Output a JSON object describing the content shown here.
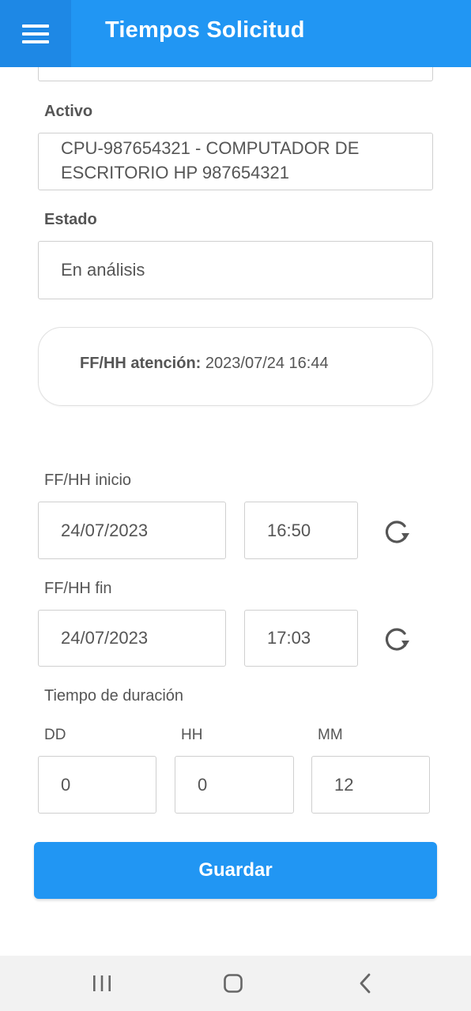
{
  "header": {
    "title": "Tiempos Solicitud",
    "menu_icon": "hamburger-menu-icon",
    "color": "#2196f3"
  },
  "form": {
    "activo": {
      "label": "Activo",
      "value": "CPU-987654321 - COMPUTADOR DE ESCRITORIO HP 987654321"
    },
    "estado": {
      "label": "Estado",
      "value": "En análisis"
    },
    "atencion": {
      "label": "FF/HH atención:",
      "value": "2023/07/24 16:44"
    },
    "inicio": {
      "label": "FF/HH inicio",
      "date": "24/07/2023",
      "time": "16:50",
      "refresh_icon": "refresh-icon"
    },
    "fin": {
      "label": "FF/HH fin",
      "date": "24/07/2023",
      "time": "17:03",
      "refresh_icon": "refresh-icon"
    },
    "duracion": {
      "label": "Tiempo de duración",
      "dd_label": "DD",
      "dd_value": "0",
      "hh_label": "HH",
      "hh_value": "0",
      "mm_label": "MM",
      "mm_value": "12"
    },
    "save_label": "Guardar"
  },
  "system_nav": {
    "recent_icon": "recent-apps-icon",
    "home_icon": "home-icon",
    "back_icon": "back-icon"
  }
}
